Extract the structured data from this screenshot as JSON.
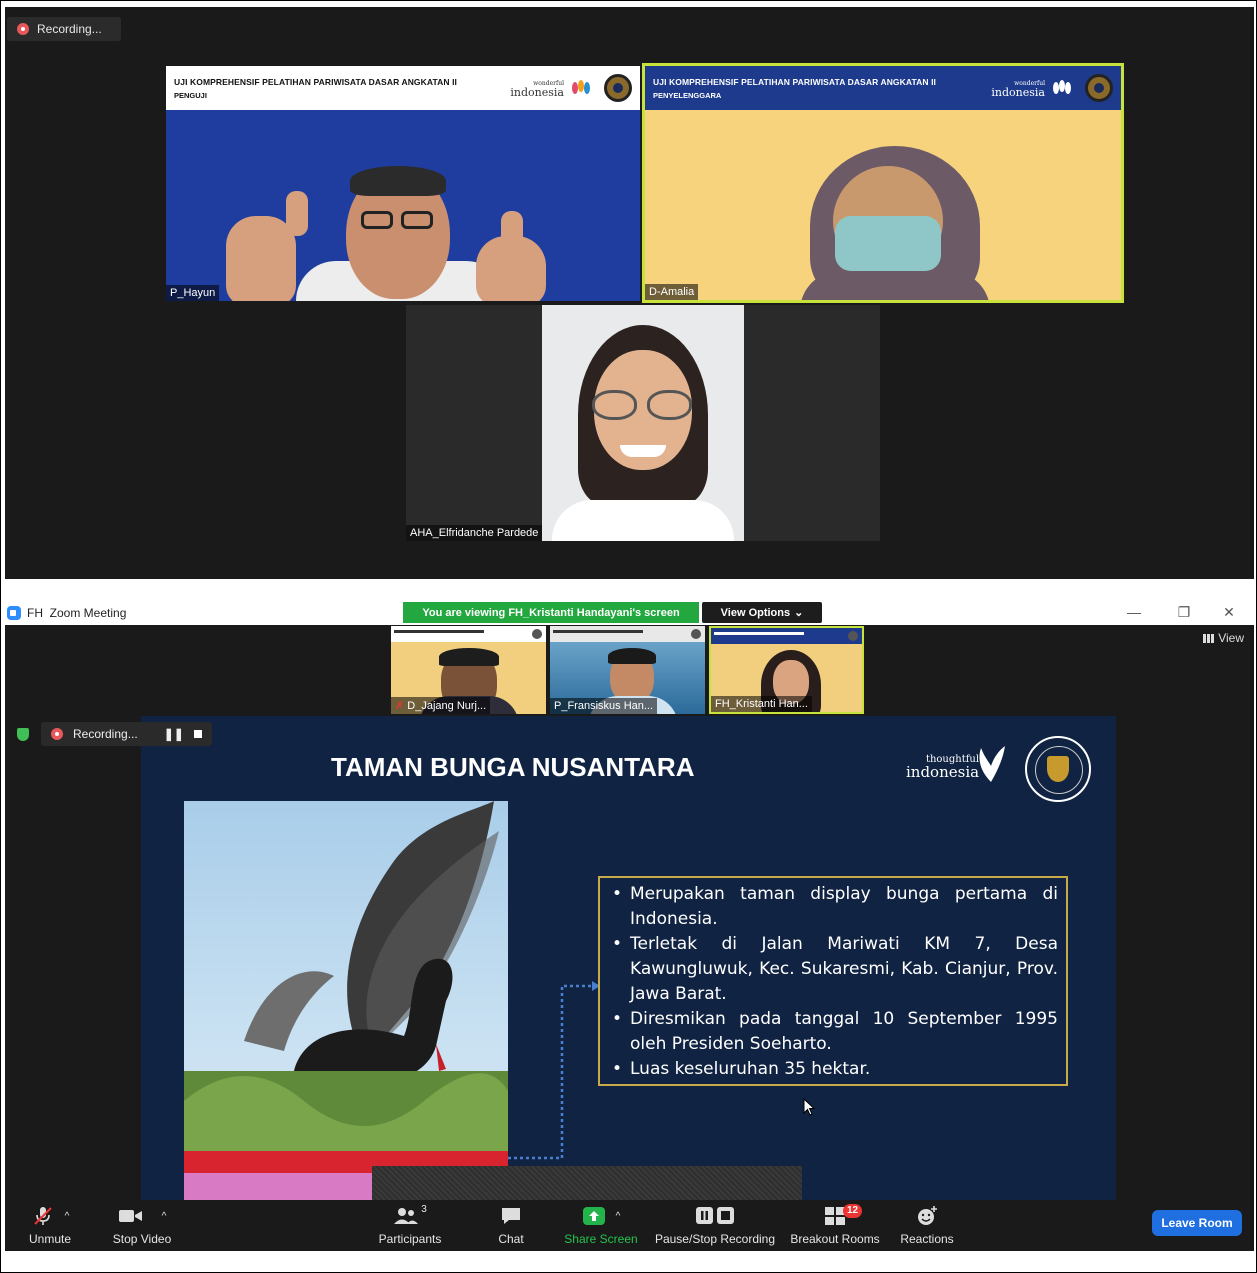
{
  "top": {
    "recording_label": "Recording...",
    "tiles": [
      {
        "banner_line1": "UJI KOMPREHENSIF PELATIHAN PARIWISATA DASAR ANGKATAN II",
        "banner_line2": "PENGUJI",
        "name": "P_Hayun",
        "bg": "#1f3d9e"
      },
      {
        "banner_line1": "UJI KOMPREHENSIF PELATIHAN PARIWISATA DASAR ANGKATAN II",
        "banner_line2": "PENYELENGGARA",
        "name": "D-Amalia",
        "bg": "#f6d37c",
        "active_border": "#c7e23a"
      },
      {
        "name": "AHA_Elfridanche Pardede"
      }
    ],
    "wonderful_logo_small": "wonderful",
    "wonderful_logo_big": "indonesia"
  },
  "window": {
    "app_short": "FH",
    "title": "Zoom Meeting",
    "viewing_banner": "You are viewing FH_Kristanti Handayani's screen",
    "view_options": "View Options",
    "view_options_chevron": "⌄",
    "minimize": "—",
    "restore": "❐",
    "close": "✕",
    "view_button": "View"
  },
  "thumbnails": [
    {
      "name": "D_Jajang Nurj..."
    },
    {
      "name": "P_Fransiskus Han..."
    },
    {
      "name": "FH_Kristanti Han..."
    }
  ],
  "recording_bar": {
    "label": "Recording..."
  },
  "slide": {
    "title": "TAMAN BUNGA NUSANTARA",
    "logo_small": "thoughtful",
    "logo_big": "indonesia",
    "bullets": [
      "Merupakan taman display bunga pertama di Indonesia.",
      "Terletak di Jalan Mariwati KM 7, Desa Kawungluwuk, Kec. Sukaresmi, Kab. Cianjur, Prov. Jawa Barat.",
      "Diresmikan pada tanggal 10 September 1995 oleh Presiden Soeharto.",
      "Luas keseluruhan 35 hektar."
    ]
  },
  "toolbar": {
    "unmute": "Unmute",
    "stop_video": "Stop Video",
    "participants": "Participants",
    "participants_count": "3",
    "chat": "Chat",
    "share_screen": "Share Screen",
    "pause_stop_recording": "Pause/Stop Recording",
    "breakout_rooms": "Breakout Rooms",
    "breakout_badge": "12",
    "reactions": "Reactions",
    "leave": "Leave Room"
  },
  "colors": {
    "share_green": "#23a83f",
    "leave_blue": "#1f6fe0",
    "slide_navy": "#102342",
    "slide_border_gold": "#c8a94a"
  }
}
